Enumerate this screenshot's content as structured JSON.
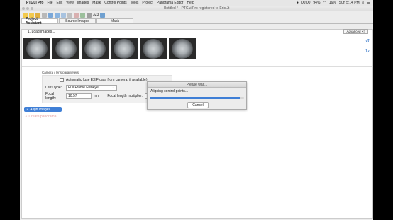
{
  "menubar": {
    "apple": "",
    "app": "PTGui Pro",
    "items": [
      "File",
      "Edit",
      "View",
      "Images",
      "Mask",
      "Control Points",
      "Tools",
      "Project",
      "Panorama Editor",
      "Help"
    ],
    "status": {
      "recording": "00:00",
      "battery_percent": "94%",
      "battery2": "16%",
      "time": "Sun 5:14 PM"
    }
  },
  "window": {
    "title": "Untitled * - PTGui Pro registered to Eric Jt"
  },
  "toolbar": {
    "count": "323"
  },
  "tabs": [
    "Project Assistant",
    "Source Images",
    "Mask"
  ],
  "main": {
    "step1": "1. Load images...",
    "advanced": "Advanced >>",
    "cam_label": "Camera / lens parameters",
    "auto_exif": "Automatic (use EXIF data from camera, if available)",
    "lens_type_label": "Lens type:",
    "lens_type_value": "Full Frame Fisheye",
    "focal_label": "Focal length:",
    "focal_value": "10.57",
    "focal_unit": "mm",
    "multiplier_label": "Focal length multiplier:",
    "multiplier_value": "1",
    "step2": "2. Align images...",
    "step3": "3. Create panorama..."
  },
  "dialog": {
    "title": "Please wait...",
    "message": "Aligning control points...",
    "progress": 0.96,
    "cancel": "Cancel"
  },
  "colors": {
    "accent": "#3f7fd6"
  }
}
